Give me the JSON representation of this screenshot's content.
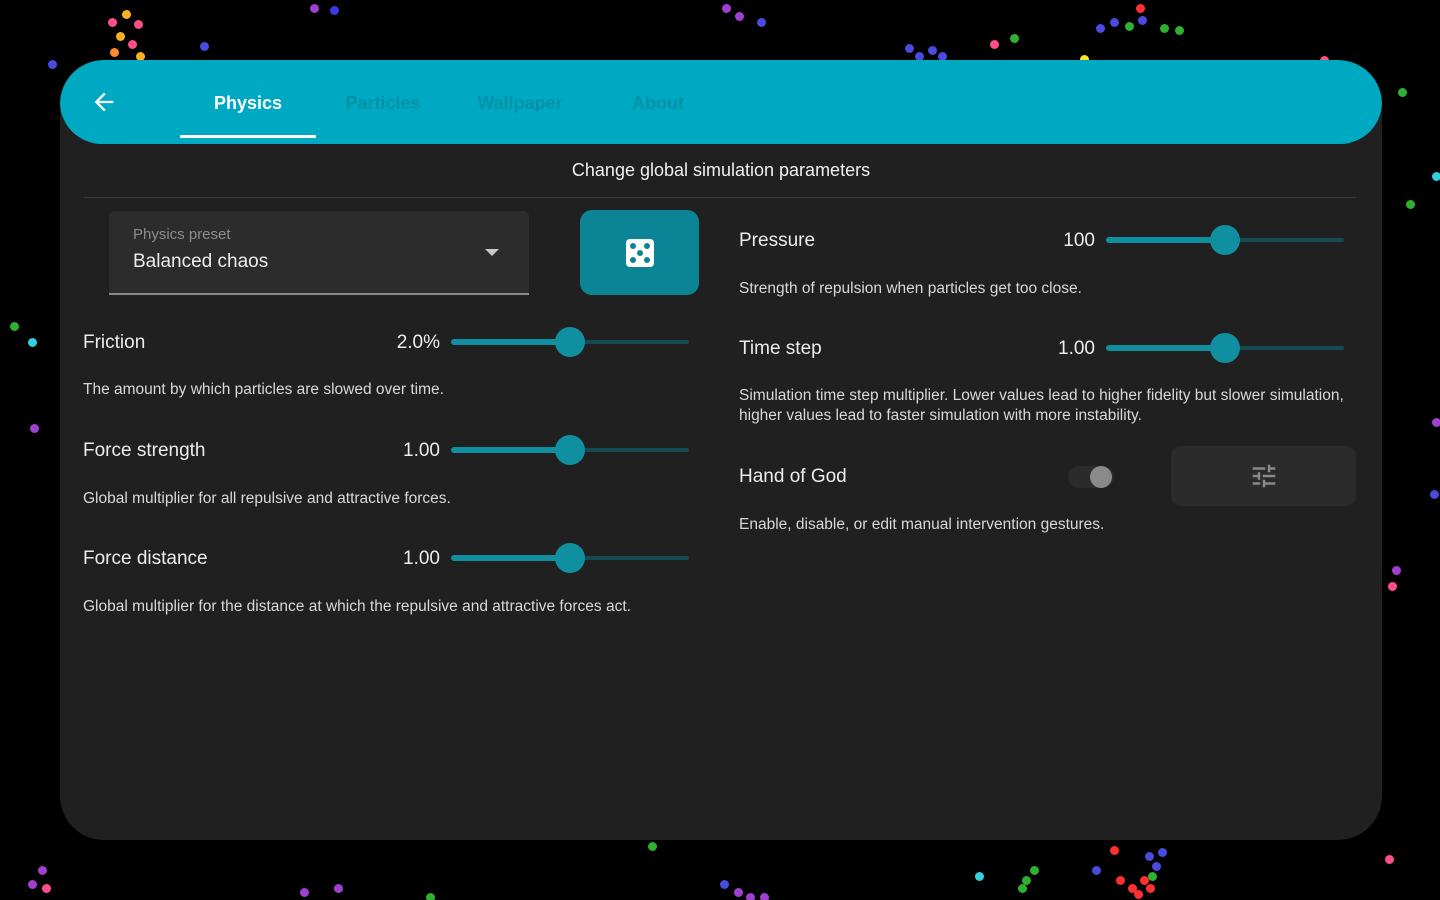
{
  "colors": {
    "accent": "#00a9c2",
    "accent_dark": "#0b8595",
    "slider": "#0f8fa0",
    "panel": "#202020"
  },
  "header": {
    "back_icon": "arrow-left-icon",
    "tabs": [
      {
        "label": "Physics",
        "active": true
      },
      {
        "label": "Particles",
        "active": false
      },
      {
        "label": "Wallpaper",
        "active": false
      },
      {
        "label": "About",
        "active": false
      }
    ]
  },
  "subtitle": "Change global simulation parameters",
  "preset": {
    "label": "Physics preset",
    "value": "Balanced chaos",
    "randomize_icon": "dice-icon"
  },
  "settings": {
    "friction": {
      "label": "Friction",
      "value": "2.0%",
      "fraction": 0.5,
      "description": "The amount by which particles are slowed over time."
    },
    "force_strength": {
      "label": "Force strength",
      "value": "1.00",
      "fraction": 0.5,
      "description": "Global multiplier for all repulsive and attractive forces."
    },
    "force_distance": {
      "label": "Force distance",
      "value": "1.00",
      "fraction": 0.5,
      "description": "Global multiplier for the distance at which the repulsive and attractive forces act."
    },
    "pressure": {
      "label": "Pressure",
      "value": "100",
      "fraction": 0.5,
      "description": "Strength of repulsion when particles get too close."
    },
    "time_step": {
      "label": "Time step",
      "value": "1.00",
      "fraction": 0.5,
      "description": "Simulation time step multiplier. Lower values lead to higher fidelity but slower simulation, higher values lead to faster simulation with more instability."
    },
    "hand_of_god": {
      "label": "Hand of God",
      "enabled": false,
      "description": "Enable, disable, or edit manual intervention gestures.",
      "edit_icon": "tune-sliders-icon"
    }
  }
}
